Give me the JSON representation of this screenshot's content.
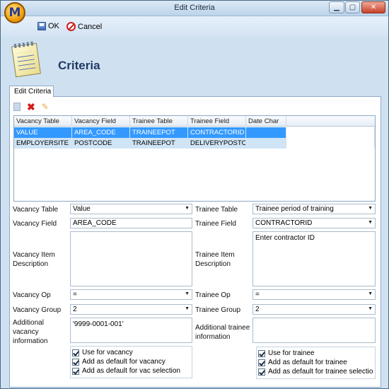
{
  "window": {
    "title": "Edit Criteria"
  },
  "toolbar": {
    "ok_label": "OK",
    "cancel_label": "Cancel"
  },
  "header": {
    "title": "Criteria"
  },
  "tab": {
    "label": "Edit Criteria"
  },
  "grid": {
    "columns": [
      "Vacancy Table",
      "Vacancy Field",
      "Trainee Table",
      "Trainee Field",
      "Date Char"
    ],
    "rows": [
      [
        "VALUE",
        "AREA_CODE",
        "TRAINEEPOT",
        "CONTRACTORID",
        ""
      ],
      [
        "EMPLOYERSITE",
        "POSTCODE",
        "TRAINEEPOT",
        "DELIVERYPOSTCC",
        ""
      ]
    ]
  },
  "form": {
    "vacancy_table": {
      "label": "Vacancy Table",
      "value": "Value"
    },
    "vacancy_field": {
      "label": "Vacancy Field",
      "value": "AREA_CODE"
    },
    "vacancy_desc": {
      "label_1": "Vacancy Item",
      "label_2": "Description",
      "value": ""
    },
    "vacancy_op": {
      "label": "Vacancy Op",
      "value": "="
    },
    "vacancy_group": {
      "label": "Vacancy Group",
      "value": "2"
    },
    "vacancy_additional": {
      "label_1": "Additional",
      "label_2": "vacancy",
      "label_3": "information",
      "value": "'9999-0001-001'"
    },
    "trainee_table": {
      "label": "Trainee Table",
      "value": "Trainee period of training"
    },
    "trainee_field": {
      "label": "Trainee Field",
      "value": "CONTRACTORID"
    },
    "trainee_desc": {
      "label_1": "Trainee Item",
      "label_2": "Description",
      "value": "Enter contractor ID"
    },
    "trainee_op": {
      "label": "Trainee Op",
      "value": "="
    },
    "trainee_group": {
      "label": "Trainee Group",
      "value": "2"
    },
    "trainee_additional": {
      "label_1": "Additional trainee",
      "label_2": "information",
      "value": ""
    }
  },
  "vacancy_checks": [
    {
      "label": "Use for vacancy",
      "checked": true
    },
    {
      "label": "Add as default for vacancy",
      "checked": true
    },
    {
      "label": "Add as default for vac selection",
      "checked": true
    }
  ],
  "trainee_checks": [
    {
      "label": "Use for trainee",
      "checked": true
    },
    {
      "label": "Add as default for trainee",
      "checked": true
    },
    {
      "label": "Add as default for trainee selectio",
      "checked": true
    }
  ],
  "icons": {
    "app": "app-logo-icon",
    "ok": "save-icon",
    "cancel": "cancel-icon",
    "header": "notepad-icon",
    "grid_new": "new-row-icon",
    "grid_delete": "delete-icon",
    "grid_edit": "edit-icon"
  },
  "colors": {
    "selected_row": "#3399ff",
    "alt_row": "#cfe4f6",
    "header_title": "#233a66"
  }
}
